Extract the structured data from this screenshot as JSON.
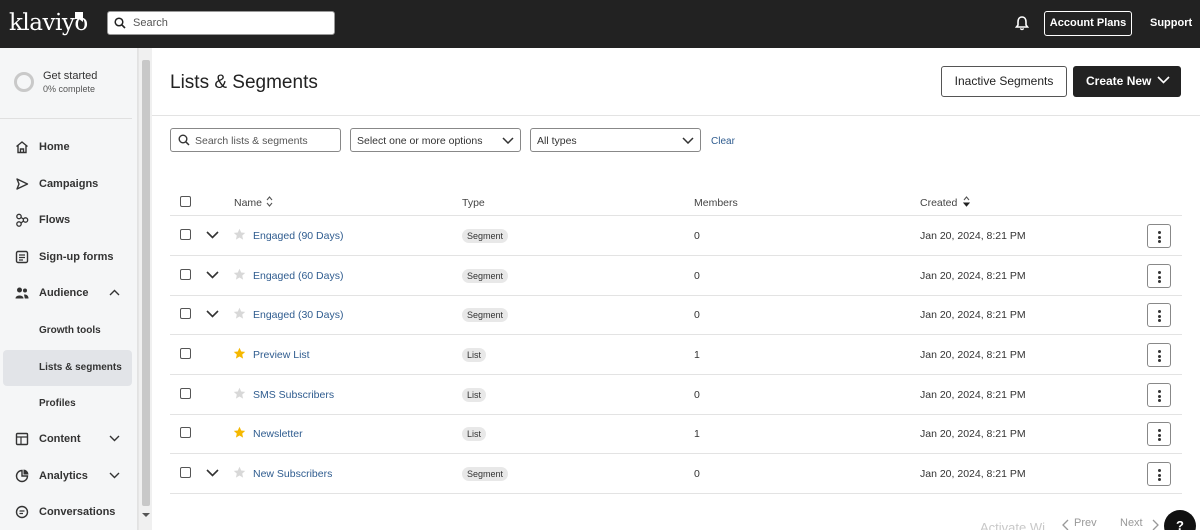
{
  "topbar": {
    "logo": "klaviyo",
    "search_placeholder": "Search",
    "account_plans": "Account Plans",
    "support": "Support"
  },
  "sidebar": {
    "get_started_title": "Get started",
    "get_started_progress": "0% complete",
    "items": [
      {
        "label": "Home",
        "icon": "home-icon"
      },
      {
        "label": "Campaigns",
        "icon": "send-icon"
      },
      {
        "label": "Flows",
        "icon": "flows-icon"
      },
      {
        "label": "Sign-up forms",
        "icon": "form-icon"
      },
      {
        "label": "Audience",
        "icon": "users-icon"
      },
      {
        "label": "Content",
        "icon": "content-icon"
      },
      {
        "label": "Analytics",
        "icon": "analytics-icon"
      },
      {
        "label": "Conversations",
        "icon": "chat-icon"
      }
    ],
    "audience_sub": [
      "Growth tools",
      "Lists & segments",
      "Profiles"
    ]
  },
  "main": {
    "title": "Lists & Segments",
    "inactive_segments": "Inactive Segments",
    "create_new": "Create New",
    "filters": {
      "search_placeholder": "Search lists & segments",
      "tags_placeholder": "Select one or more options",
      "type_value": "All types",
      "clear": "Clear"
    },
    "table": {
      "columns": {
        "name": "Name",
        "type": "Type",
        "members": "Members",
        "created": "Created"
      },
      "rows": [
        {
          "name": "Engaged (90 Days)",
          "type": "Segment",
          "members": "0",
          "created": "Jan 20, 2024, 8:21 PM",
          "starred": false,
          "expandable": true
        },
        {
          "name": "Engaged (60 Days)",
          "type": "Segment",
          "members": "0",
          "created": "Jan 20, 2024, 8:21 PM",
          "starred": false,
          "expandable": true
        },
        {
          "name": "Engaged (30 Days)",
          "type": "Segment",
          "members": "0",
          "created": "Jan 20, 2024, 8:21 PM",
          "starred": false,
          "expandable": true
        },
        {
          "name": "Preview List",
          "type": "List",
          "members": "1",
          "created": "Jan 20, 2024, 8:21 PM",
          "starred": true,
          "expandable": false
        },
        {
          "name": "SMS Subscribers",
          "type": "List",
          "members": "0",
          "created": "Jan 20, 2024, 8:21 PM",
          "starred": false,
          "expandable": false
        },
        {
          "name": "Newsletter",
          "type": "List",
          "members": "1",
          "created": "Jan 20, 2024, 8:21 PM",
          "starred": true,
          "expandable": false
        },
        {
          "name": "New Subscribers",
          "type": "Segment",
          "members": "0",
          "created": "Jan 20, 2024, 8:21 PM",
          "starred": false,
          "expandable": true
        }
      ]
    },
    "pagination": {
      "prev": "Prev",
      "next": "Next"
    },
    "watermark": "Activate Wi",
    "help": "?"
  },
  "colors": {
    "topbar": "#222222",
    "link": "#2f5c8f",
    "star_active": "#f5b800",
    "star_inactive": "#d8d8d8"
  }
}
